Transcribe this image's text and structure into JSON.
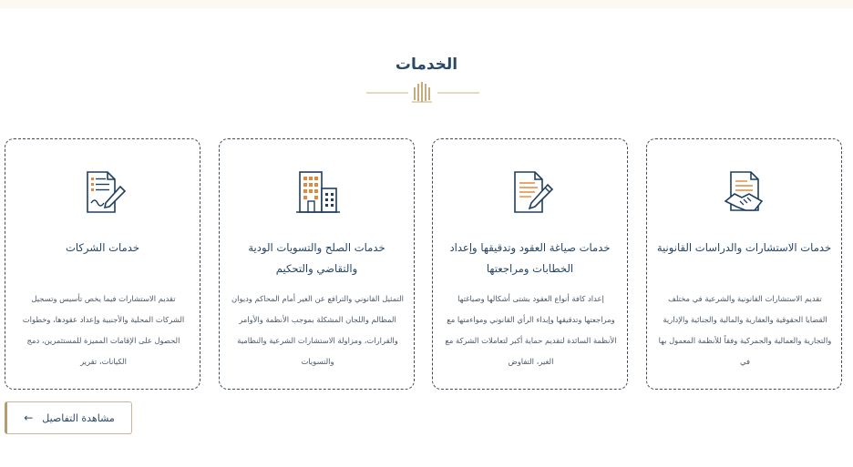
{
  "section": {
    "title": "الخدمات"
  },
  "colors": {
    "navy": "#1f3f5f",
    "gold": "#b89a6c",
    "orange": "#e08a3c"
  },
  "cards": [
    {
      "title": "خدمات الاستشارات والدراسات القانونية",
      "icon": "document-handshake-icon",
      "description": "تقديم الاستشارات القانونية والشرعية في مختلف القضايا الحقوقية والعقارية والمالية والجنائية والإدارية والتجارية والعمالية والجمركية وفقاً للأنظمة المعمول بها في"
    },
    {
      "title": "خدمات صياغة العقود وتدقيقها وإعداد الخطابات ومراجعتها",
      "icon": "document-pen-icon",
      "description": "إعداد كافة أنواع العقود بشتى أشكالها وصياغتها ومراجعتها وتدقيقها وإبداء الرأي القانوني ومواءمتها مع الأنظمة السائدة لتقديم حماية أكبر لتعاملات الشركة مع الغير، التفاوض"
    },
    {
      "title": "خدمات الصلح والتسويات الودية والتقاضي والتحكيم",
      "icon": "buildings-icon",
      "description": "التمثيل القانوني والترافع عن الغير أمام المحاكم وديوان المظالم واللجان المشكلة بموجب الأنظمة والأوامر والقرارات، ومزاولة الاستشارات الشرعية والنظامية والتسويات"
    },
    {
      "title": "خدمات الشركات",
      "icon": "document-sign-icon",
      "description": "تقديم الاستشارات فيما يخص تأسيس وتسجيل الشركات المحلية والأجنبية وإعداد عقودها، وخطوات الحصول على الإقامات المميزة للمستثمرين، دمج الكيانات، تقرير"
    }
  ],
  "button": {
    "label": "مشاهدة التفاصيل",
    "arrow": "←"
  }
}
